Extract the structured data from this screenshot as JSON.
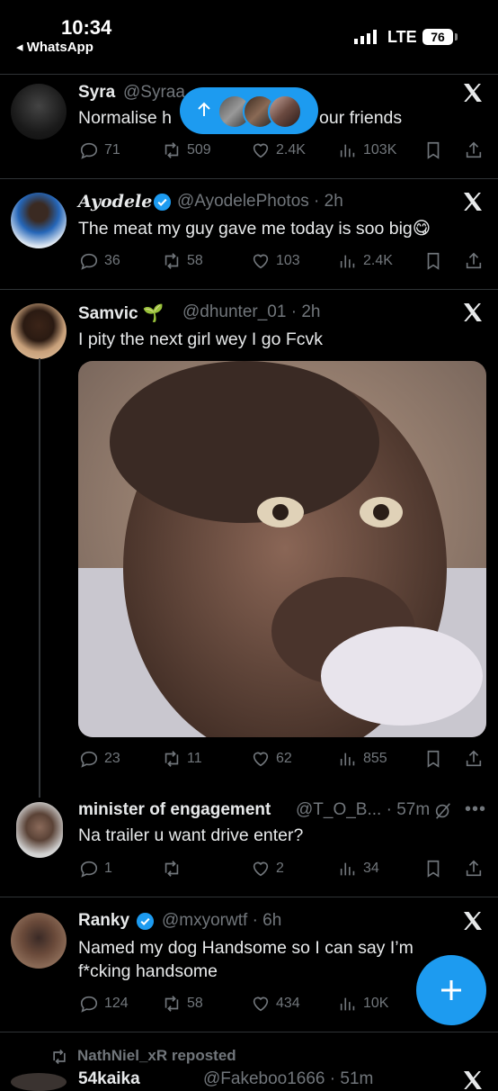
{
  "status_bar": {
    "time": "10:34",
    "back_app": "◂ WhatsApp",
    "network": "LTE",
    "battery": "76"
  },
  "tweets": [
    {
      "name": "Syra",
      "handle": "@Syraa...",
      "text": "Normalise h",
      "text2": "our friends",
      "replies": "71",
      "reposts": "509",
      "likes": "2.4K",
      "views": "103K"
    },
    {
      "name": "Ayodele",
      "handle": "@AyodelePhotos · 2h",
      "text": "The meat my guy gave me today is soo big😋",
      "replies": "36",
      "reposts": "58",
      "likes": "103",
      "views": "2.4K"
    },
    {
      "name": "Samvic 🌱",
      "handle": "@dhunter_01 · 2h",
      "text": "I pity the next girl wey I go Fcvk",
      "replies": "23",
      "reposts": "11",
      "likes": "62",
      "views": "855"
    },
    {
      "name": "minister of engagement",
      "handle": "@T_O_B... · 57m",
      "text": "Na trailer u want drive enter?",
      "replies": "1",
      "reposts": "",
      "likes": "2",
      "views": "34"
    },
    {
      "name": "Ranky",
      "handle": "@mxyorwtf · 6h",
      "text": "Named my dog Handsome so I can say I’m",
      "text2": "f*cking handsome",
      "replies": "124",
      "reposts": "58",
      "likes": "434",
      "views": "10K"
    }
  ],
  "repost_banner": "NathNiel_xR reposted",
  "next_tweet_name": "54kaika",
  "next_tweet_handle": "@Fakeboo1666 · 51m",
  "colors": {
    "accent": "#1d9bf0",
    "muted": "#71767b",
    "text": "#e7e9ea",
    "background": "#000000"
  }
}
